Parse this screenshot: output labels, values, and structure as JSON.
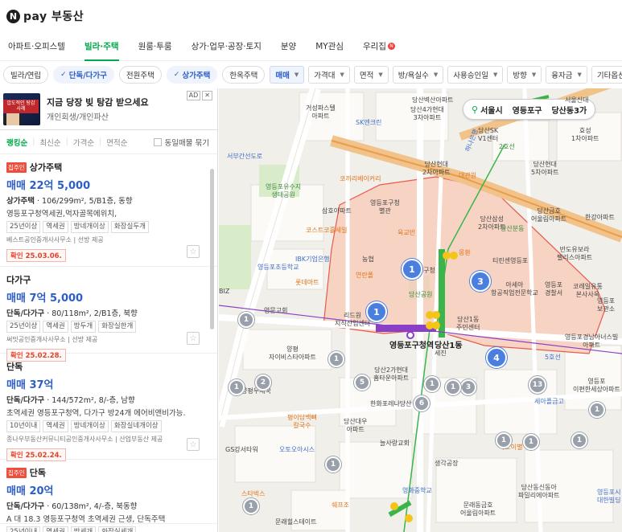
{
  "header": {
    "logo_mark": "N",
    "logo_text": "pay 부동산"
  },
  "nav": {
    "tabs": [
      {
        "label": "아파트·오피스텔"
      },
      {
        "label": "빌라·주택"
      },
      {
        "label": "원룸·투룸"
      },
      {
        "label": "상가·업무·공장·토지"
      },
      {
        "label": "분양"
      },
      {
        "label": "MY관심"
      },
      {
        "label": "우리집"
      }
    ],
    "active_index": 1,
    "new_badge": "N"
  },
  "filters": {
    "chips": [
      {
        "label": "빌라/연립",
        "on": false
      },
      {
        "label": "단독/다가구",
        "on": true
      },
      {
        "label": "전원주택",
        "on": false
      },
      {
        "label": "상가주택",
        "on": true
      },
      {
        "label": "한옥주택",
        "on": false
      }
    ],
    "check_glyph": "✓",
    "dropdowns": [
      {
        "label": "매매",
        "on": true
      },
      {
        "label": "가격대",
        "on": false
      },
      {
        "label": "면적",
        "on": false
      },
      {
        "label": "방/욕실수",
        "on": false
      },
      {
        "label": "사용승인일",
        "on": false
      },
      {
        "label": "방향",
        "on": false
      },
      {
        "label": "융자금",
        "on": false
      },
      {
        "label": "기타옵션",
        "on": false
      }
    ]
  },
  "ad": {
    "thumb_text": "압도적인 탕감사례",
    "title": "지금 당장 빚 탕감 받으세요",
    "subtitle": "개인회생/개인파산",
    "ad_label": "AD",
    "close": "✕"
  },
  "sort": {
    "options": [
      "랭킹순",
      "최신순",
      "가격순",
      "면적순"
    ],
    "active_index": 0,
    "same_listing": "동일매물 묶기"
  },
  "listings": [
    {
      "badge": "집주인",
      "name": "상가주택",
      "price": "매매 22억 5,000",
      "type": "상가주택",
      "spec": " · 106/299m², 5/B1층, 동향",
      "desc": "영등포구청역세권,먹자골목에위치,",
      "tags": [
        "25년이상",
        "역세권",
        "방네개이상",
        "화장실두개"
      ],
      "agency": "베스트공인중개사사무소 | 선방 제공",
      "confirm": "확인 25.03.06."
    },
    {
      "badge": "",
      "name": "다가구",
      "price": "매매 7억 5,000",
      "type": "단독/다가구",
      "spec": " · 80/118m², 2/B1층, 북향",
      "desc": "",
      "tags": [
        "25년이상",
        "역세권",
        "방두개",
        "화장실한개"
      ],
      "agency": "써밋공인중개사사무소 | 선방 제공",
      "confirm": "확인 25.02.28."
    },
    {
      "badge": "",
      "name": "단독",
      "price": "매매 37억",
      "type": "단독/다가구",
      "spec": " · 144/572m², 8/-층, 남향",
      "desc": "초역세권 영등포구청역, 다가구 방24개 에어비앤비가능.",
      "tags": [
        "10년이내",
        "역세권",
        "방네개이상",
        "화장실네개이상"
      ],
      "agency": "종나우부동산커뮤니티공인중개사사무소 | 산업부동산 제공",
      "confirm": "확인 25.02.24."
    },
    {
      "badge": "집주인",
      "name": "단독",
      "price": "매매 20억",
      "type": "단독/다가구",
      "spec": " · 60/138m², 4/-층, 북동향",
      "desc": "A 대 18.3 영등포구청역 초역세권 근생, 단독주택",
      "tags": [
        "25년이내",
        "역세권",
        "방세개",
        "화장실세개"
      ],
      "agency": "",
      "confirm": ""
    }
  ],
  "favorite_glyph": "☆",
  "map": {
    "location": {
      "pin": "⚲",
      "city": "서울시",
      "district": "영등포구",
      "dong": "당산동3가"
    },
    "big_labels": [
      {
        "text": "영등포구청역"
      },
      {
        "text": "당산1동"
      }
    ],
    "places": [
      {
        "text": "거성파스텔\n아파트"
      },
      {
        "text": "당산4가현대\n3차아파트"
      },
      {
        "text": "SK엔크린"
      },
      {
        "text": "당산SK\nV1센터"
      },
      {
        "text": "효성\n1차아파트"
      },
      {
        "text": "당산현대\n5차아파트"
      },
      {
        "text": "당산현대\n2차아파트"
      },
      {
        "text": "코끼리베이커리"
      },
      {
        "text": "영등포유수지\n생태공원"
      },
      {
        "text": "영등포구청\n별관"
      },
      {
        "text": "삼호아파트"
      },
      {
        "text": "당산삼성\n2차아파트"
      },
      {
        "text": "당산금호\n어울림아파트"
      },
      {
        "text": "한강아파트"
      },
      {
        "text": "코스트코홀세일"
      },
      {
        "text": "반도유보라\n팰리스아파트"
      },
      {
        "text": "IBK기업은행"
      },
      {
        "text": "농협"
      },
      {
        "text": "티린센영등포"
      },
      {
        "text": "영등포초등학교"
      },
      {
        "text": "영등포구청"
      },
      {
        "text": "아세아\n항공직업전문학교"
      },
      {
        "text": "영등포\n경찰서"
      },
      {
        "text": "코레일유통\n본사사옥"
      },
      {
        "text": "롯데마트"
      },
      {
        "text": "당산공원"
      },
      {
        "text": "영문교회"
      },
      {
        "text": "리드원\n지식산업센터"
      },
      {
        "text": "당산1동\n주민센터"
      },
      {
        "text": "영등포경남아너스빌\n아파트"
      },
      {
        "text": "양평\n자이비스타아파트"
      },
      {
        "text": "당산2가현대\n홈타운아파트"
      },
      {
        "text": "영등포\n이편한세상아파트"
      },
      {
        "text": "양평우체국"
      },
      {
        "text": "세아플금고"
      },
      {
        "text": "한화포레나당산"
      },
      {
        "text": "평이담백뼈\n칼국수"
      },
      {
        "text": "당산대우\n아파트"
      },
      {
        "text": "GS강서타워"
      },
      {
        "text": "오토오아시스"
      },
      {
        "text": "늘사랑교회"
      },
      {
        "text": "하노이별"
      },
      {
        "text": "생각공장"
      },
      {
        "text": "영화중학교"
      },
      {
        "text": "당산동신동아\n파밀리에아파트"
      },
      {
        "text": "스타벅스"
      },
      {
        "text": "문래동금호\n어울림아파트"
      },
      {
        "text": "쉐프조"
      },
      {
        "text": "문래힐스테이트"
      },
      {
        "text": "영등포시\n대한빌딩"
      },
      {
        "text": "세진"
      },
      {
        "text": "당산벽산아파트"
      },
      {
        "text": "육교반"
      },
      {
        "text": "연란폴"
      },
      {
        "text": "몽환"
      },
      {
        "text": "대관원"
      },
      {
        "text": "당산분동"
      },
      {
        "text": "서울신대"
      },
      {
        "text": "영등포\n보관소"
      },
      {
        "text": "BIZ"
      },
      {
        "text": "하나은행"
      },
      {
        "text": "서부간선도로"
      },
      {
        "text": "2호선"
      },
      {
        "text": "5호선"
      }
    ],
    "clusters": [
      {
        "count": "1",
        "style": "blue"
      },
      {
        "count": "3",
        "style": "blue"
      },
      {
        "count": "1",
        "style": "blue"
      },
      {
        "count": "4",
        "style": "blue"
      },
      {
        "count": "1",
        "style": "gray"
      },
      {
        "count": "1",
        "style": "gray"
      },
      {
        "count": "2",
        "style": "gray"
      },
      {
        "count": "5",
        "style": "gray"
      },
      {
        "count": "1",
        "style": "gray"
      },
      {
        "count": "3",
        "style": "gray"
      },
      {
        "count": "13",
        "style": "gray"
      },
      {
        "count": "1",
        "style": "gray"
      },
      {
        "count": "6",
        "style": "gray"
      },
      {
        "count": "1",
        "style": "gray"
      },
      {
        "count": "1",
        "style": "gray"
      },
      {
        "count": "1",
        "style": "gray"
      },
      {
        "count": "1",
        "style": "gray"
      },
      {
        "count": "1",
        "style": "gray"
      },
      {
        "count": "1",
        "style": "gray"
      },
      {
        "count": "1",
        "style": "gray"
      }
    ],
    "colors": {
      "brand_green": "#03a94d",
      "active_blue": "#2b5ec9",
      "highlight_fill": "#f7c9b5",
      "highlight_stroke": "#e85b4a",
      "road_orange": "#e99d4a",
      "line2_green": "#3bb54a",
      "line5_purple": "#8a3fc7"
    }
  }
}
